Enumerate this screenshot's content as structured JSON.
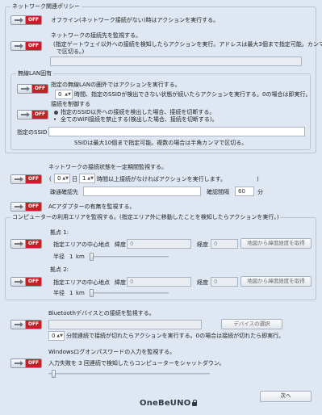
{
  "network_policy": {
    "title": "ネットワーク関連ポリシー",
    "offline": {
      "label": "オフライン(ネットワーク接続がない)時はアクションを実行する。",
      "state": "OFF"
    },
    "gateway": {
      "label": "ネットワークの接続先を監視する。",
      "desc_1": "(指定ゲートウェイ以外への接続を検知したらアクションを実行。アドレスは最大3個まで指定可能。カンマ",
      "desc_2": "で区切る。)",
      "state": "OFF",
      "input_value": ""
    },
    "wireless": {
      "title": "無線LAN固有",
      "out_of_range": {
        "label": "指定の無線LANの圏外ではアクションを実行する。",
        "seconds": "0",
        "desc": "時間、指定のSSIDが検出できない状態が続いたらアクションを実行する。0の場合は即実行。",
        "state": "OFF"
      },
      "restrict": {
        "label": "接続を制御する",
        "option_1": "指定のSSID以外への接続を検出した場合、接続を切断する。",
        "option_2": "全てのWiFi接続を禁止する(検出した場合、接続を切断する)。",
        "state": "OFF"
      },
      "ssid_label": "指定のSSID",
      "ssid_value": "",
      "ssid_note": "SSIDは最大10個まで指定可能。複数の場合は半角カンマで区切る。"
    },
    "periodic": {
      "label": "ネットワークの接続状態を一定期間監視する。",
      "days": "0",
      "day_unit": "日",
      "hours": "1",
      "hours_desc": "時間以上接続がなければアクションを実行します。",
      "target_label": "疎通確認先",
      "target_value": "",
      "interval_label": "確認間隔",
      "interval_value": "60",
      "interval_unit": "分",
      "state": "OFF"
    },
    "ac_adapter": {
      "label": "ACアダプターの有無を監視する。",
      "state": "OFF"
    }
  },
  "area": {
    "title": "コンピューターの利用エリアを監視する。(指定エリア外に移動したことを検知したらアクションを実行。)",
    "points": [
      {
        "label": "拠点  1:",
        "center": "指定エリアの中心地点",
        "lat_label": "緯度",
        "lat_value": "0",
        "lng_label": "経度",
        "lng_value": "0",
        "map_button": "地図から緯度経度を取得",
        "radius_label": "半径",
        "radius_value": "1",
        "radius_unit": "km",
        "state": "OFF"
      },
      {
        "label": "拠点  2:",
        "center": "指定エリアの中心地点",
        "lat_label": "緯度",
        "lat_value": "0",
        "lng_label": "経度",
        "lng_value": "0",
        "map_button": "地図から緯度経度を取得",
        "radius_label": "半径",
        "radius_value": "1",
        "radius_unit": "km",
        "state": "OFF"
      }
    ]
  },
  "bluetooth": {
    "label": "Bluetoothデバイスとの接続を監視する。",
    "device_value": "",
    "select_button": "デバイスの選択",
    "minutes": "0",
    "desc": "分間連続で接続が切れたらアクションを実行する。0の場合は接続が切れたら即実行。",
    "state": "OFF"
  },
  "windows_password": {
    "label": "Windowsログオンパスワードの入力を監視する。",
    "desc": "入力失敗を  3  回連続で検知したらコンピューターをシャットダウン。",
    "state": "OFF"
  },
  "footer": {
    "logo": "OneBeUNO",
    "next_button": "次へ"
  }
}
